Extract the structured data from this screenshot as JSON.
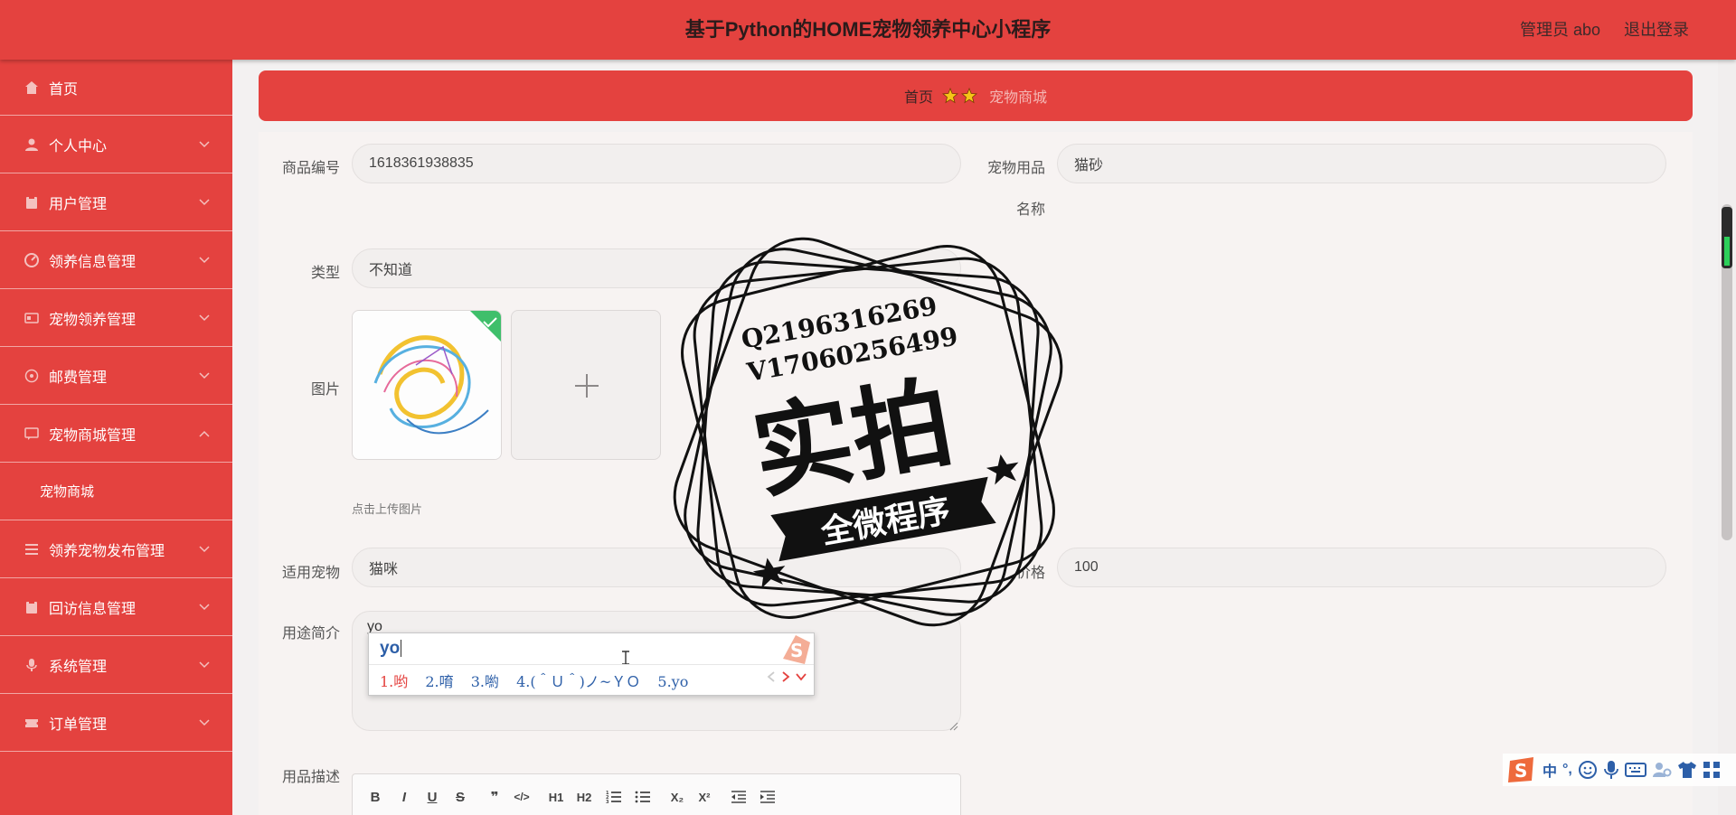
{
  "header": {
    "title": "基于Python的HOME宠物领养中心小程序",
    "user": "管理员 abo",
    "logout": "退出登录"
  },
  "sidebar": {
    "items": [
      {
        "label": "首页",
        "icon": "home-icon"
      },
      {
        "label": "个人中心",
        "icon": "user-icon"
      },
      {
        "label": "用户管理",
        "icon": "clipboard-icon"
      },
      {
        "label": "领养信息管理",
        "icon": "gauge-icon"
      },
      {
        "label": "宠物领养管理",
        "icon": "card-icon"
      },
      {
        "label": "邮费管理",
        "icon": "target-icon"
      },
      {
        "label": "宠物商城管理",
        "icon": "chat-icon"
      },
      {
        "label": "领养宠物发布管理",
        "icon": "list-icon"
      },
      {
        "label": "回访信息管理",
        "icon": "clipboard-icon"
      },
      {
        "label": "系统管理",
        "icon": "mic-icon"
      },
      {
        "label": "订单管理",
        "icon": "ticket-icon"
      }
    ],
    "submenu": {
      "label": "宠物商城"
    }
  },
  "breadcrumb": {
    "home": "首页",
    "current": "宠物商城"
  },
  "form": {
    "product_no_label": "商品编号",
    "product_no_value": "1618361938835",
    "supply_name_label_1": "宠物用品",
    "supply_name_label_2": "名称",
    "supply_name_value": "猫砂",
    "type_label": "类型",
    "type_value": "不知道",
    "image_label": "图片",
    "upload_tip": "点击上传图片",
    "pet_label": "适用宠物",
    "pet_value": "猫咪",
    "price_label": "价格",
    "price_value": "100",
    "usage_label": "用途简介",
    "usage_value": "yo",
    "desc_label": "用品描述"
  },
  "ime": {
    "composition": "yo",
    "candidates": [
      "1.哟",
      "2.唷",
      "3.喲",
      "4.(＾Ｕ＾)ノ~ＹＯ",
      "5.yo"
    ]
  },
  "editor_toolbar": [
    "B",
    "I",
    "U",
    "S",
    "❞",
    "</>",
    "H1",
    "H2",
    "ol",
    "ul",
    "X₂",
    "X²",
    "outdent",
    "indent"
  ],
  "stamp": {
    "line1": "Q2196316269",
    "line2": "V17060256499",
    "main": "实拍",
    "banner": "全微程序"
  },
  "imebar": {
    "lang": "中",
    "punct": "°,"
  },
  "colors": {
    "primary": "#e4423f",
    "text_dark": "#2b1b1b",
    "accent_blue": "#2d5fa8"
  }
}
